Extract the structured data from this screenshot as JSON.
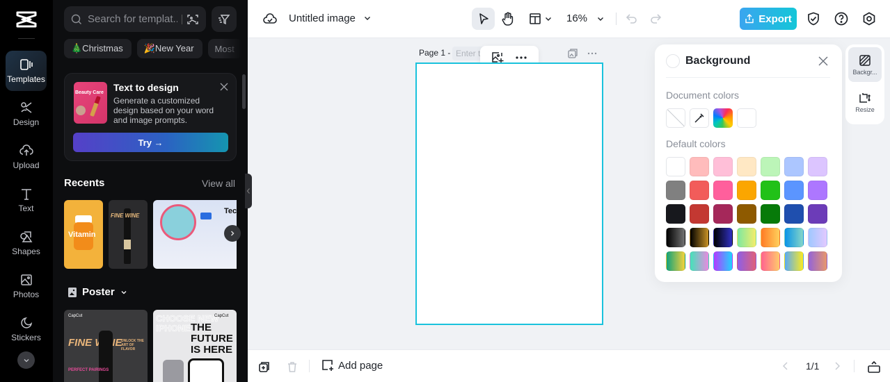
{
  "rail": {
    "items": [
      {
        "label": "Templates",
        "icon": "templates-icon",
        "active": true
      },
      {
        "label": "Design",
        "icon": "design-icon"
      },
      {
        "label": "Upload",
        "icon": "upload-cloud-icon"
      },
      {
        "label": "Text",
        "icon": "text-icon"
      },
      {
        "label": "Shapes",
        "icon": "shapes-icon"
      },
      {
        "label": "Photos",
        "icon": "photo-icon"
      },
      {
        "label": "Stickers",
        "icon": "sticker-icon"
      }
    ]
  },
  "panel": {
    "search_placeholder": "Search for templat...",
    "chips": [
      "🎄Christmas",
      "🎉New Year",
      "Most"
    ],
    "promo": {
      "thumb_text": "Beauty Care",
      "title": "Text to design",
      "description": "Generate a customized design based on your word and image prompts.",
      "button": "Try →"
    },
    "recents": {
      "title": "Recents",
      "view_all": "View all",
      "thumbs": [
        {
          "text": "Vitamin"
        },
        {
          "text": "FINE WINE"
        },
        {
          "text": "Tec"
        }
      ]
    },
    "poster": {
      "title": "Poster",
      "tiles": [
        {
          "title": "FINE WINE",
          "subtitle": "PERFECT PAIRINGS",
          "side": "UNLOCK THE ART OF FLAVOR",
          "brand": "CapCut"
        },
        {
          "title": "THE FUTURE IS HERE",
          "outline": "CHOOSE NEW IPHONE",
          "brand": "CapCut"
        }
      ]
    }
  },
  "topbar": {
    "doc_title": "Untitled image",
    "zoom": "16%",
    "export": "Export"
  },
  "canvas": {
    "page_label": "Page 1 -",
    "page_name_placeholder": "Enter title"
  },
  "background_panel": {
    "title": "Background",
    "document_colors_label": "Document colors",
    "document_colors": [
      "none",
      "eyedropper",
      "rainbow",
      "#ffffff"
    ],
    "default_colors_label": "Default colors",
    "default_colors": [
      "#ffffff",
      "#ffbcbc",
      "#ffbfd8",
      "#ffe8c4",
      "#bcf5b8",
      "#acc6ff",
      "#dcc5ff",
      "#808080",
      "#f25c5a",
      "#ff5f9c",
      "#fba600",
      "#21c118",
      "#5b95ff",
      "#ad77ff",
      "#17181d",
      "#c33832",
      "#a5285a",
      "#8e5a00",
      "#077a09",
      "#1f4fae",
      "#6c3cb8",
      "linear-gradient(90deg,#000,#737373)",
      "linear-gradient(90deg,#000,#c89225)",
      "linear-gradient(90deg,#000,#3131c3)",
      "linear-gradient(90deg,#7ee8a0,#f4ed6b)",
      "linear-gradient(90deg,#ff7b25,#ffd05c)",
      "linear-gradient(90deg,#0a94e8,#86d6c8)",
      "linear-gradient(90deg,#9fc8ff,#e3c9ff)",
      "linear-gradient(90deg,#12a27b,#f4d23b)",
      "linear-gradient(90deg,#44e3b9,#e88ae0)",
      "linear-gradient(90deg,#b33cff,#21d3ff)",
      "linear-gradient(90deg,#8e5fe6,#e0607a)",
      "linear-gradient(90deg,#ff6390,#ffcb6b)",
      "linear-gradient(90deg,#5aaaf5,#f9ea23)",
      "linear-gradient(90deg,#9464d8,#e8976c)"
    ]
  },
  "right_rail": {
    "items": [
      {
        "label": "Backgr...",
        "active": true
      },
      {
        "label": "Resize"
      }
    ]
  },
  "bottombar": {
    "add_page": "Add page",
    "pages": "1/1"
  }
}
